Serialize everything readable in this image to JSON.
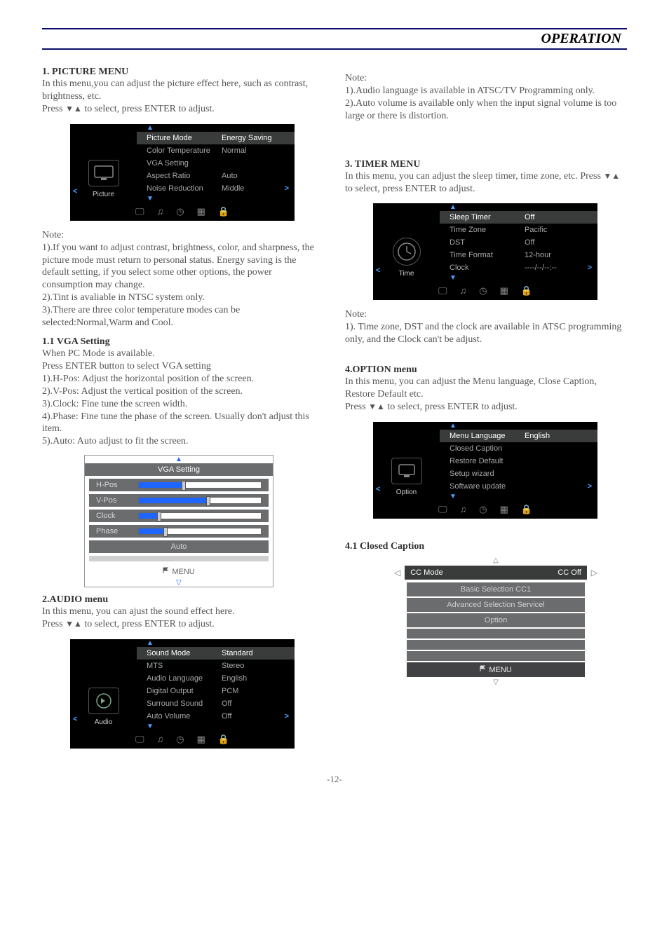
{
  "header": {
    "title": "OPERATION"
  },
  "s1": {
    "title": "1. PICTURE MENU",
    "intro1": "In this menu,you can adjust the picture effect here, such as contrast, brightness, etc.",
    "intro2_pre": "Press ",
    "intro2_post": " to select, press ENTER to adjust.",
    "osd": {
      "left_label": "Picture",
      "rows": [
        {
          "label": "Picture Mode",
          "value": "Energy Saving",
          "hl": true
        },
        {
          "label": "Color Temperature",
          "value": "Normal"
        },
        {
          "label": "VGA Setting",
          "value": ""
        },
        {
          "label": "Aspect Ratio",
          "value": "Auto"
        },
        {
          "label": "Noise Reduction",
          "value": "Middle"
        }
      ]
    },
    "note_label": "Note:",
    "note1": "1).If you want to adjust contrast, brightness, color, and sharpness, the picture mode must return to personal status. Energy saving is the default setting, if you select some other options, the power consumption may change.",
    "note2": "2).Tint is avaliable in NTSC system only.",
    "note3": "3).There are three color temperature modes can be selected:Normal,Warm and Cool."
  },
  "s1_1": {
    "title": "1.1 VGA Setting",
    "lines": [
      "When PC Mode is available.",
      "Press ENTER button to select VGA setting",
      "1).H-Pos: Adjust the horizontal position of the screen.",
      "2).V-Pos: Adjust the vertical position of the screen.",
      "3).Clock: Fine tune the screen width.",
      "4).Phase: Fine tune the phase of the screen. Usually don't adjust this item.",
      "5).Auto: Auto adjust to fit the screen."
    ],
    "panel": {
      "title": "VGA Setting",
      "rows": [
        {
          "label": "H-Pos",
          "fill": 35
        },
        {
          "label": "V-Pos",
          "fill": 55
        },
        {
          "label": "Clock",
          "fill": 15
        },
        {
          "label": "Phase",
          "fill": 20
        }
      ],
      "auto_label": "Auto",
      "menu_label": "MENU"
    }
  },
  "s2": {
    "title": "2.AUDIO menu",
    "intro1": "In this menu, you can ajust the sound effect here.",
    "intro2_pre": "Press ",
    "intro2_post": " to select, press ENTER to adjust.",
    "osd": {
      "left_label": "Audio",
      "rows": [
        {
          "label": "Sound Mode",
          "value": "Standard",
          "hl": true
        },
        {
          "label": "MTS",
          "value": "Stereo"
        },
        {
          "label": "Audio Language",
          "value": "English"
        },
        {
          "label": "Digital Output",
          "value": "PCM"
        },
        {
          "label": "Surround Sound",
          "value": "Off"
        },
        {
          "label": "Auto Volume",
          "value": "Off"
        }
      ]
    },
    "note_label": "Note:",
    "note1": "1).Audio language is available in ATSC/TV Programming only.",
    "note2": "2).Auto volume is available only when the input signal volume is too large or there is distortion."
  },
  "s3": {
    "title": "3. TIMER MENU",
    "intro_pre": "In this menu, you can adjust the sleep timer, time zone, etc. Press ",
    "intro_post": " to select, press ENTER to adjust.",
    "osd": {
      "left_label": "Time",
      "rows": [
        {
          "label": "Sleep Timer",
          "value": "Off",
          "hl": true
        },
        {
          "label": "Time Zone",
          "value": "Pacific"
        },
        {
          "label": "DST",
          "value": "Off"
        },
        {
          "label": "Time Format",
          "value": "12-hour"
        },
        {
          "label": "Clock",
          "value": "----/--/--:--"
        }
      ]
    },
    "note_label": "Note:",
    "note1": "1). Time zone, DST and the clock are available in ATSC programming only, and the Clock can't be adjust."
  },
  "s4": {
    "title": "4.OPTION menu",
    "intro1": "In this menu, you can adjust the Menu language, Close Caption, Restore Default etc.",
    "intro2_pre": "Press ",
    "intro2_post": " to select, press ENTER to adjust.",
    "osd": {
      "left_label": "Option",
      "rows": [
        {
          "label": "Menu Language",
          "value": "English",
          "hl": true
        },
        {
          "label": "Closed Caption",
          "value": ""
        },
        {
          "label": "Restore Default",
          "value": ""
        },
        {
          "label": "Setup wizard",
          "value": ""
        },
        {
          "label": "Software update",
          "value": ""
        }
      ]
    }
  },
  "s4_1": {
    "title": "4.1 Closed Caption",
    "panel": {
      "row1_label": "CC Mode",
      "row1_value": "CC Off",
      "rows": [
        "Basic Selection CC1",
        "Advanced Selection Servicel",
        "Option"
      ],
      "menu_label": "MENU"
    }
  },
  "footer": {
    "page": "-12-"
  }
}
